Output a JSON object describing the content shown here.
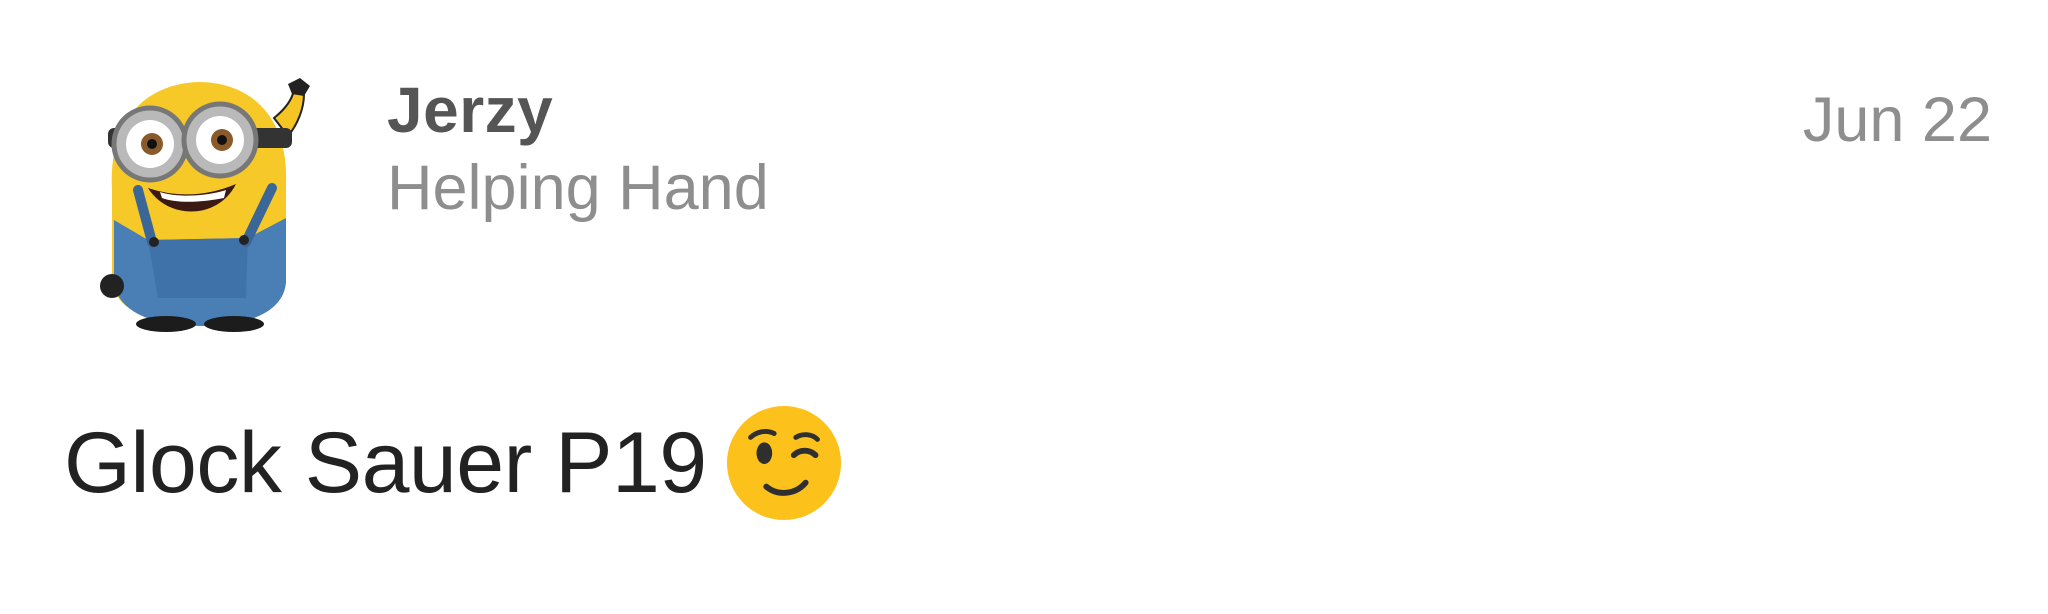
{
  "post": {
    "author": {
      "name": "Jerzy",
      "title": "Helping Hand",
      "avatar_icon": "minion-avatar"
    },
    "date": "Jun 22",
    "body": {
      "text": "Glock Sauer P19",
      "emoji_icon": "winking-face-emoji"
    }
  },
  "colors": {
    "background": "#ffffff",
    "author_name": "#555555",
    "secondary_text": "#8e8e8e",
    "body_text": "#222222",
    "emoji_yellow": "#fcc21b"
  }
}
